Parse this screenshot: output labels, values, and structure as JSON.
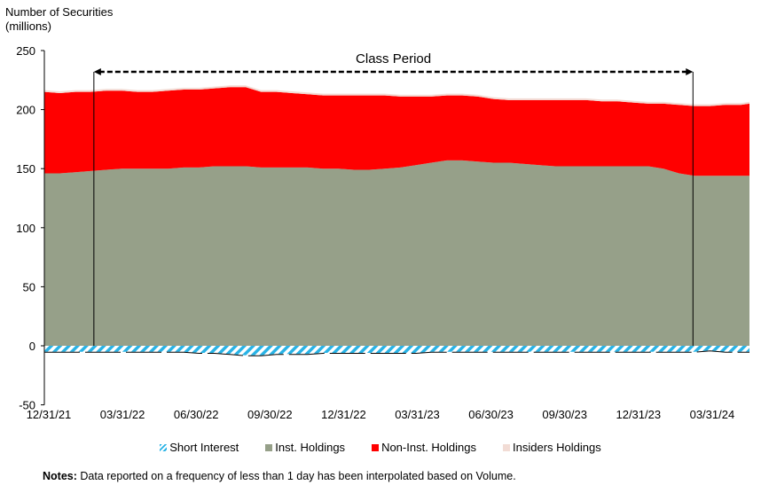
{
  "chart_data": {
    "type": "area",
    "title": "",
    "ylabel": "Number of Securities (millions)",
    "xlabel": "",
    "ylim": [
      -50,
      250
    ],
    "yticks": [
      -50,
      0,
      50,
      100,
      150,
      200,
      250
    ],
    "xlim": [
      "12/31/21",
      "06/28/24"
    ],
    "xtick_labels": [
      "12/31/21",
      "03/31/22",
      "06/30/22",
      "09/30/22",
      "12/31/22",
      "03/31/23",
      "06/30/23",
      "09/30/23",
      "12/31/23",
      "03/31/24"
    ],
    "x_days": [
      0,
      20,
      40,
      60,
      80,
      100,
      120,
      140,
      160,
      180,
      200,
      220,
      240,
      260,
      280,
      300,
      320,
      340,
      360,
      380,
      400,
      420,
      440,
      460,
      480,
      500,
      520,
      540,
      560,
      580,
      600,
      620,
      640,
      660,
      680,
      700,
      720,
      740,
      760,
      780,
      800,
      820,
      840,
      860,
      880,
      900,
      911
    ],
    "series": [
      {
        "name": "Short Interest",
        "color": "#29B3E6",
        "pattern": "hatched",
        "values": [
          -5,
          -5,
          -5,
          -5,
          -5,
          -5,
          -5,
          -5,
          -5,
          -5,
          -6,
          -6,
          -7,
          -8,
          -8,
          -7,
          -7,
          -7,
          -6,
          -6,
          -6,
          -6,
          -6,
          -6,
          -6,
          -5,
          -5,
          -5,
          -5,
          -5,
          -5,
          -5,
          -5,
          -5,
          -5,
          -5,
          -5,
          -5,
          -5,
          -5,
          -5,
          -5,
          -5,
          -4,
          -5,
          -5,
          -5
        ]
      },
      {
        "name": "Inst. Holdings",
        "color": "#96A089",
        "values": [
          146,
          146,
          147,
          148,
          149,
          150,
          150,
          150,
          150,
          151,
          151,
          152,
          152,
          152,
          151,
          151,
          151,
          151,
          150,
          150,
          149,
          149,
          150,
          151,
          153,
          155,
          157,
          157,
          156,
          155,
          155,
          154,
          153,
          152,
          152,
          152,
          152,
          152,
          152,
          152,
          150,
          146,
          144,
          144,
          144,
          144,
          144
        ]
      },
      {
        "name": "Non-Inst. Holdings",
        "color": "#FF0000",
        "values": [
          69,
          68,
          68,
          67,
          67,
          66,
          65,
          65,
          66,
          66,
          66,
          66,
          67,
          67,
          64,
          64,
          63,
          62,
          62,
          62,
          63,
          63,
          62,
          60,
          58,
          56,
          55,
          55,
          55,
          54,
          53,
          54,
          55,
          56,
          56,
          56,
          55,
          55,
          54,
          53,
          55,
          58,
          59,
          59,
          60,
          60,
          61
        ]
      },
      {
        "name": "Insiders Holdings",
        "color": "#F2DCD5",
        "values": [
          1.5,
          1.5,
          1.5,
          1.5,
          1.5,
          1.5,
          1.5,
          1.5,
          1.5,
          1.5,
          1.5,
          1.5,
          1.5,
          1.5,
          1.5,
          1.5,
          1.5,
          1.5,
          1.5,
          1.5,
          1.5,
          1.5,
          1.5,
          1.5,
          1.5,
          1.5,
          1.5,
          1.5,
          1.5,
          1.5,
          1.5,
          1.5,
          1.5,
          1.5,
          1.5,
          1.5,
          1.5,
          1.5,
          1.5,
          1.5,
          1.5,
          1.5,
          1.5,
          1.5,
          1.5,
          1.5,
          1.5
        ]
      }
    ],
    "annotations": [
      {
        "text": "Class Period",
        "start_day": 64,
        "end_day": 838,
        "arrow_level": 232
      }
    ],
    "grid": false,
    "legend_position": "bottom"
  },
  "labels": {
    "y_axis_title_line1": "Number of Securities",
    "y_axis_title_line2": "(millions)",
    "notes_bold": "Notes:",
    "notes_text": " Data reported on a frequency of less than 1 day has been interpolated based on Volume."
  }
}
